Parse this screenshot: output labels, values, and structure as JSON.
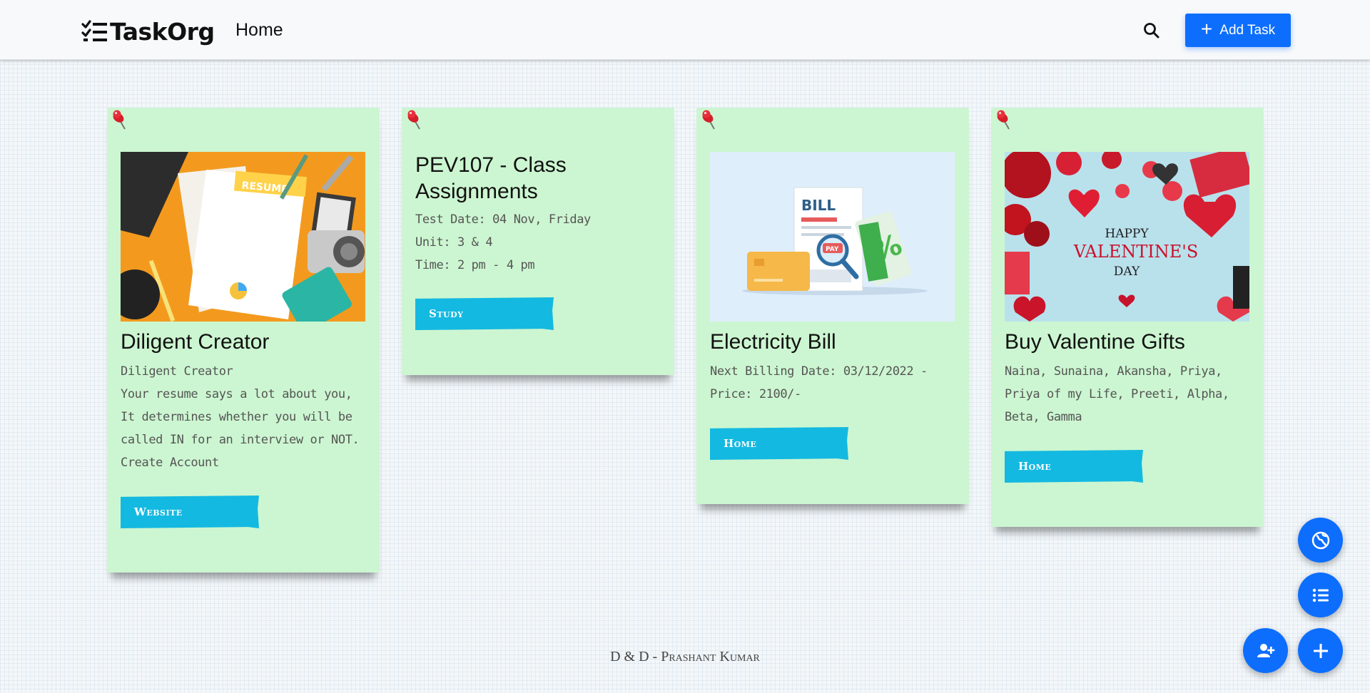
{
  "navbar": {
    "brand": "TaskOrg",
    "brand_icon": "checklist-icon",
    "home_link": "Home",
    "search_icon": "search-icon",
    "add_task_label": "Add Task"
  },
  "cards": [
    {
      "title": "Diligent Creator",
      "image": "resume-illustration",
      "lines": [
        "Diligent Creator",
        "Your resume says a lot about you,",
        "It determines whether you will be",
        "called IN for an interview or NOT.",
        "Create Account"
      ],
      "tag": "Website"
    },
    {
      "title": "PEV107 - Class Assignments",
      "lines": [
        "Test Date: 04 Nov, Friday",
        "Unit: 3 & 4",
        "Time: 2 pm - 4 pm"
      ],
      "tag": "Study"
    },
    {
      "title": "Electricity Bill",
      "image": "bill-illustration",
      "image_text": {
        "bill": "BILL",
        "pay": "PAY",
        "percent": "%"
      },
      "lines": [
        "Next Billing Date: 03/12/2022 -",
        "Price: 2100/-"
      ],
      "tag": "Home"
    },
    {
      "title": "Buy Valentine Gifts",
      "image": "valentine-photo",
      "image_text": {
        "line1": "HAPPY",
        "line2": "VALENTINE'S",
        "line3": "DAY"
      },
      "lines": [
        "Naina, Sunaina, Akansha, Priya,",
        "Priya of my Life, Preeti, Alpha,",
        "Beta, Gamma"
      ],
      "tag": "Home"
    }
  ],
  "footer": "D & D - Prashant Kumar",
  "fabs": [
    "globe-icon",
    "list-icon",
    "add-user-icon",
    "plus-icon"
  ],
  "colors": {
    "accent": "#0d6efd",
    "card": "#ccf6d1",
    "tag": "#14b9e1"
  }
}
